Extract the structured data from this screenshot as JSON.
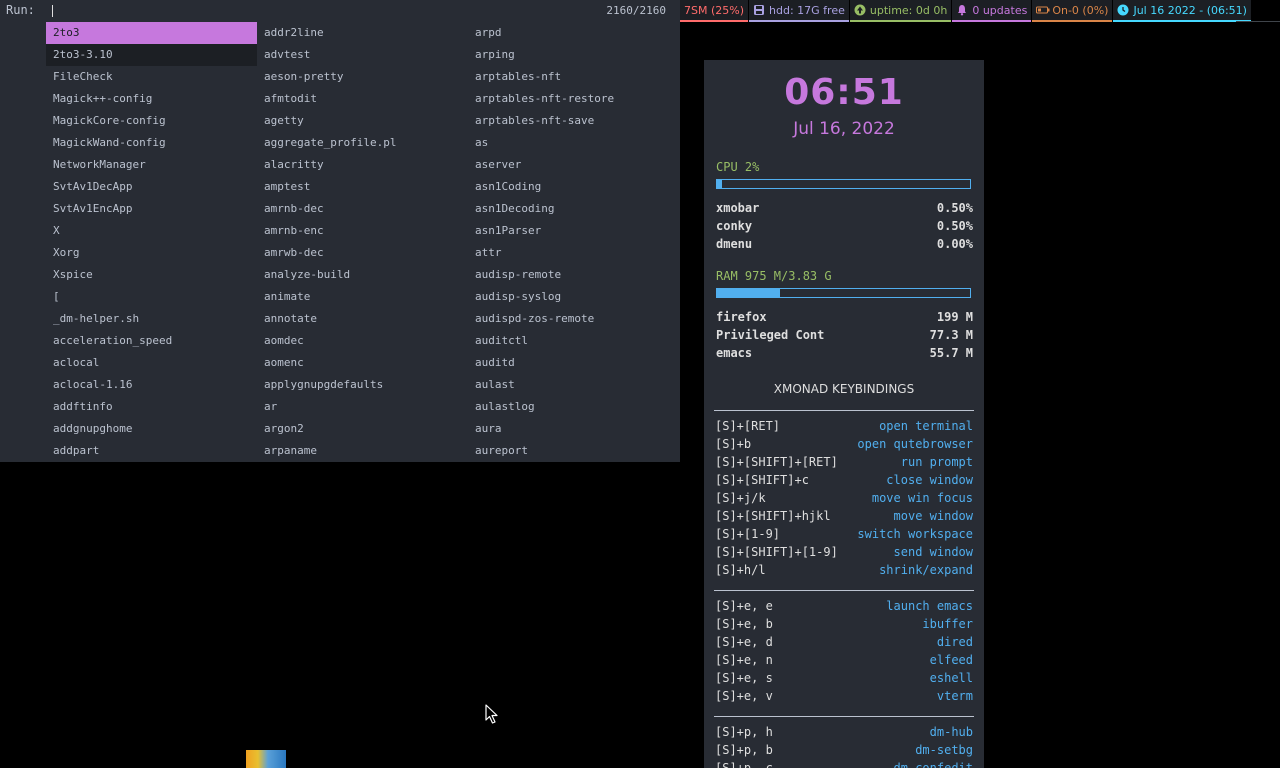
{
  "dmenu": {
    "prompt": "Run:",
    "input_value": "",
    "match_count": "2160/2160",
    "selected_color": "#c678dd",
    "columns": [
      [
        "2to3",
        "2to3-3.10",
        "FileCheck",
        "Magick++-config",
        "MagickCore-config",
        "MagickWand-config",
        "NetworkManager",
        "SvtAv1DecApp",
        "SvtAv1EncApp",
        "X",
        "Xorg",
        "Xspice",
        "[",
        "_dm-helper.sh",
        "acceleration_speed",
        "aclocal",
        "aclocal-1.16",
        "addftinfo",
        "addgnupghome",
        "addpart"
      ],
      [
        "addr2line",
        "advtest",
        "aeson-pretty",
        "afmtodit",
        "agetty",
        "aggregate_profile.pl",
        "alacritty",
        "amptest",
        "amrnb-dec",
        "amrnb-enc",
        "amrwb-dec",
        "analyze-build",
        "animate",
        "annotate",
        "aomdec",
        "aomenc",
        "applygnupgdefaults",
        "ar",
        "argon2",
        "arpaname"
      ],
      [
        "arpd",
        "arping",
        "arptables-nft",
        "arptables-nft-restore",
        "arptables-nft-save",
        "as",
        "aserver",
        "asn1Coding",
        "asn1Decoding",
        "asn1Parser",
        "attr",
        "audisp-remote",
        "audisp-syslog",
        "audispd-zos-remote",
        "auditctl",
        "auditd",
        "aulast",
        "aulastlog",
        "aura",
        "aureport"
      ]
    ]
  },
  "xmobar": {
    "items": [
      {
        "text": "7SM (25%)",
        "color": "#ff6c6b",
        "icon": "none"
      },
      {
        "text": "hdd: 17G free",
        "color": "#a9a1e1",
        "icon": "disk-icon"
      },
      {
        "text": "uptime: 0d 0h",
        "color": "#98be65",
        "icon": "uptime-icon"
      },
      {
        "text": "0 updates",
        "color": "#c678dd",
        "icon": "bell-icon"
      },
      {
        "text": "On-0 (0%)",
        "color": "#da8548",
        "icon": "battery-icon"
      },
      {
        "text": "Jul 16 2022 - (06:51)",
        "color": "#46d9ff",
        "icon": "clock-icon"
      }
    ]
  },
  "conky": {
    "time": "06:51",
    "date": "Jul 16, 2022",
    "cpu": {
      "label": "CPU  2%",
      "fraction": 0.02
    },
    "cpu_procs": [
      {
        "name": "xmobar",
        "value": "0.50%"
      },
      {
        "name": "conky",
        "value": "0.50%"
      },
      {
        "name": "dmenu",
        "value": "0.00%"
      }
    ],
    "ram": {
      "label": "RAM  975 M/3.83 G",
      "fraction": 0.25
    },
    "ram_procs": [
      {
        "name": "firefox",
        "value": "199 M"
      },
      {
        "name": "Privileged Cont",
        "value": "77.3 M"
      },
      {
        "name": "emacs",
        "value": "55.7 M"
      }
    ],
    "keybindings_title": "XMONAD KEYBINDINGS",
    "keybinding_groups": [
      [
        {
          "key": "[S]+[RET]",
          "action": "open terminal"
        },
        {
          "key": "[S]+b",
          "action": "open qutebrowser"
        },
        {
          "key": "[S]+[SHIFT]+[RET]",
          "action": "run prompt"
        },
        {
          "key": "[S]+[SHIFT]+c",
          "action": "close window"
        },
        {
          "key": "[S]+j/k",
          "action": "move win focus"
        },
        {
          "key": "[S]+[SHIFT]+hjkl",
          "action": "move window"
        },
        {
          "key": "[S]+[1-9]",
          "action": "switch workspace"
        },
        {
          "key": "[S]+[SHIFT]+[1-9]",
          "action": "send window"
        },
        {
          "key": "[S]+h/l",
          "action": "shrink/expand"
        }
      ],
      [
        {
          "key": "[S]+e, e",
          "action": "launch emacs"
        },
        {
          "key": "[S]+e, b",
          "action": "ibuffer"
        },
        {
          "key": "[S]+e, d",
          "action": "dired"
        },
        {
          "key": "[S]+e, n",
          "action": "elfeed"
        },
        {
          "key": "[S]+e, s",
          "action": "eshell"
        },
        {
          "key": "[S]+e, v",
          "action": "vterm"
        }
      ],
      [
        {
          "key": "[S]+p, h",
          "action": "dm-hub"
        },
        {
          "key": "[S]+p, b",
          "action": "dm-setbg"
        },
        {
          "key": "[S]+p, c",
          "action": "dm-confedit"
        }
      ]
    ]
  }
}
